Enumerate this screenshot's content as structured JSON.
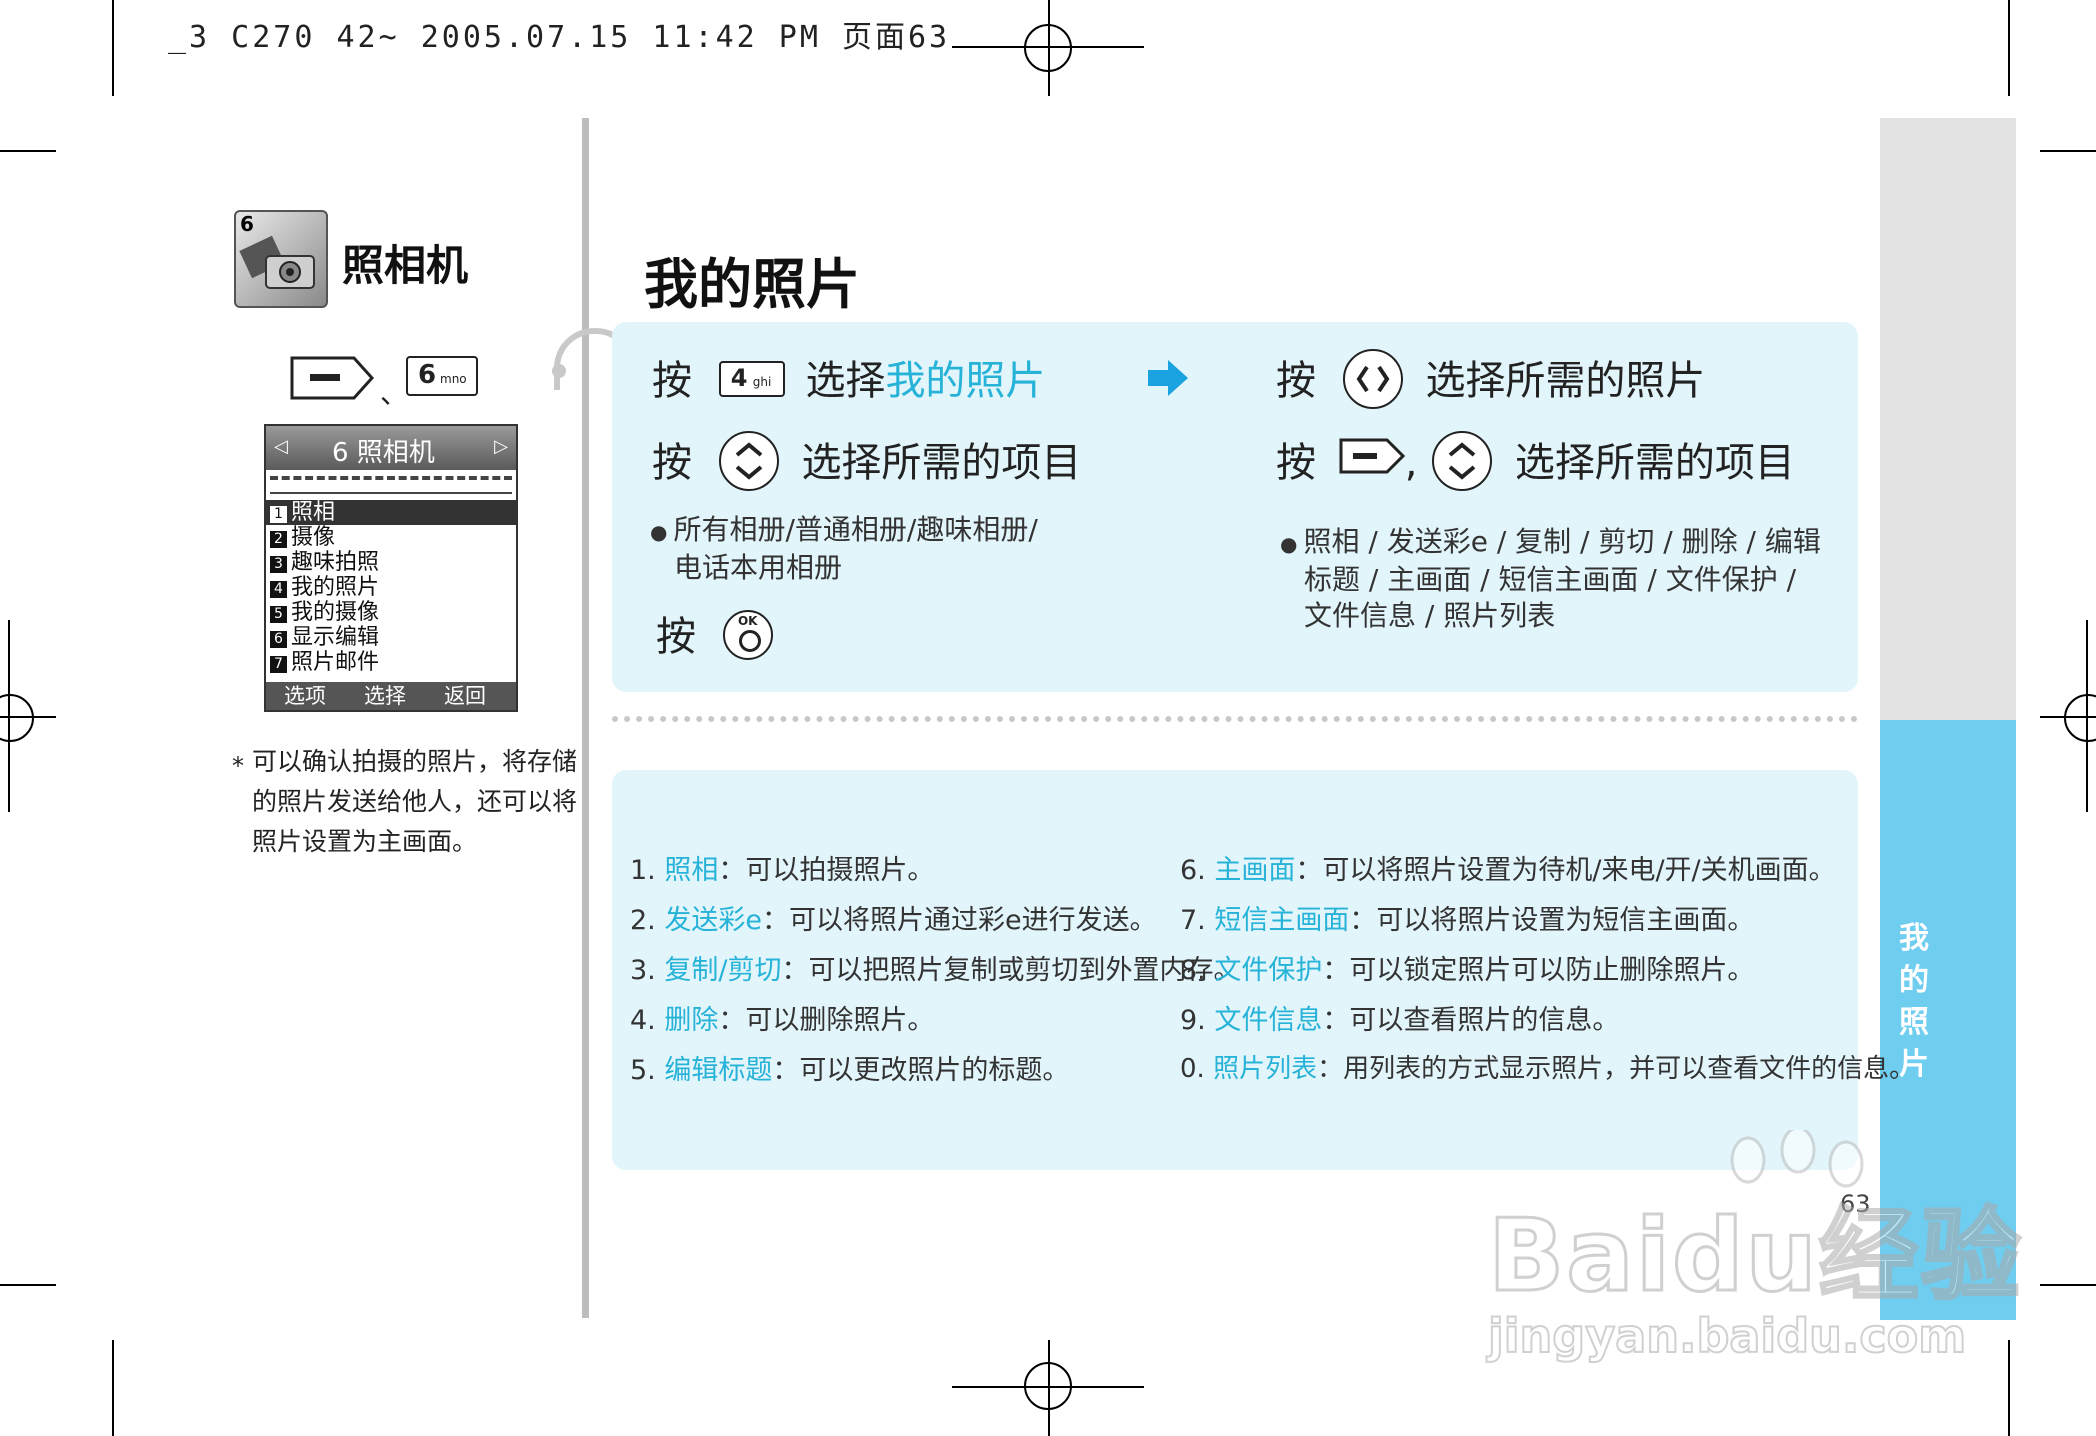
{
  "header": {
    "print_line": "_3 C270 42~ 2005.07.15 11:42 PM 页面63"
  },
  "sidebar": {
    "menu_number": "6",
    "title": "照相机",
    "keys": {
      "sep": "、",
      "key6_num": "6",
      "key6_sub": "mno"
    },
    "phone_screen": {
      "title": "6 照相机",
      "items": [
        {
          "num": "1",
          "label": "照相"
        },
        {
          "num": "2",
          "label": "摄像"
        },
        {
          "num": "3",
          "label": "趣味拍照"
        },
        {
          "num": "4",
          "label": "我的照片"
        },
        {
          "num": "5",
          "label": "我的摄像"
        },
        {
          "num": "6",
          "label": "显示编辑"
        },
        {
          "num": "7",
          "label": "照片邮件"
        }
      ],
      "softkeys": {
        "left": "选项",
        "center": "选择",
        "right": "返回"
      }
    },
    "note": "* 可以确认拍摄的照片，将存储的照片发送给他人，还可以将照片设置为主画面。",
    "note_lines": [
      "可以确认拍摄的照片，将存储",
      "的照片发送给他人，还可以将",
      "照片设置为主画面。"
    ],
    "note_star": "*"
  },
  "main": {
    "title": "我的照片",
    "steps_left": {
      "step1_press": "按",
      "key4_num": "4",
      "key4_sub": "ghi",
      "step1_text": "选择",
      "step1_highlight": "我的照片",
      "step2_press": "按",
      "step2_text": "选择所需的项目",
      "bullet_line1": "所有相册/普通相册/趣味相册/",
      "bullet_line2": "电话本用相册",
      "step3_press": "按",
      "ok_label": "OK"
    },
    "steps_right": {
      "step1_press": "按",
      "step1_text": "选择所需的照片",
      "step2_press": "按",
      "step2_comma": ",",
      "step2_text": "选择所需的项目",
      "bullet_line1": "照相 / 发送彩e / 复制 / 剪切 / 删除 / 编辑",
      "bullet_line2": "标题 / 主画面 / 短信主画面 / 文件保护 /",
      "bullet_line3": "文件信息 / 照片列表"
    },
    "functions_left": [
      {
        "num": "1.",
        "label": "照相",
        "desc": "：可以拍摄照片。"
      },
      {
        "num": "2.",
        "label": "发送彩e",
        "desc": "：可以将照片通过彩e进行发送。"
      },
      {
        "num": "3.",
        "label": "复制/剪切",
        "desc": "：可以把照片复制或剪切到外置内存。"
      },
      {
        "num": "4.",
        "label": "删除",
        "desc": "：可以删除照片。"
      },
      {
        "num": "5.",
        "label": "编辑标题",
        "desc": "：可以更改照片的标题。"
      }
    ],
    "functions_right": [
      {
        "num": "6.",
        "label": "主画面",
        "desc": "：可以将照片设置为待机/来电/开/关机画面。"
      },
      {
        "num": "7.",
        "label": "短信主画面",
        "desc": "：可以将照片设置为短信主画面。"
      },
      {
        "num": "8.",
        "label": "文件保护",
        "desc": "：可以锁定照片可以防止删除照片。"
      },
      {
        "num": "9.",
        "label": "文件信息",
        "desc": "：可以查看照片的信息。"
      },
      {
        "num": "0.",
        "label": "照片列表",
        "desc": "：用列表的方式显示照片，并可以查看文件的信息。"
      }
    ]
  },
  "side_tab": {
    "chars": [
      "我",
      "的",
      "照",
      "片"
    ]
  },
  "page_number": "63",
  "watermark": {
    "line1": "Baidu经验",
    "line2": "jingyan.baidu.com"
  },
  "colors": {
    "accent": "#27b2d8",
    "panel": "#e2f5fb",
    "side_tab": "#6fcdf0",
    "side_top": "#e3e3e3"
  }
}
